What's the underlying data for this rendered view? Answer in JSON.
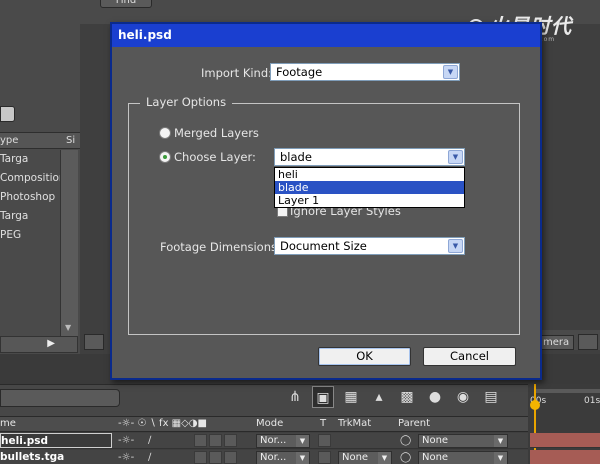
{
  "dialog": {
    "title": "heli.psd",
    "import_kind_label": "Import Kind:",
    "import_kind_value": "Footage",
    "layer_options_label": "Layer Options",
    "merged_layers_label": "Merged Layers",
    "choose_layer_label": "Choose Layer:",
    "choose_layer_value": "blade",
    "layer_options": [
      "heli",
      "blade",
      "Layer 1"
    ],
    "ignore_layer_styles_label": "Ignore Layer Styles",
    "footage_dimensions_label": "Footage Dimensions:",
    "footage_dimensions_value": "Document Size",
    "ok_label": "OK",
    "cancel_label": "Cancel"
  },
  "project_panel": {
    "find_label": "Find",
    "column_type": "ype",
    "column_size": "Si",
    "types": [
      "Targa",
      "Composition",
      "Photoshop",
      "Targa",
      "PEG"
    ]
  },
  "viewer": {
    "camera_label": "mera"
  },
  "timeline": {
    "columns": {
      "name": "me",
      "mode": "Mode",
      "t": "T",
      "trkmat": "TrkMat",
      "parent": "Parent"
    },
    "layers": [
      {
        "name": "heli.psd",
        "mode": "Nor...",
        "trkmat": "",
        "parent": "None"
      },
      {
        "name": "bullets.tga",
        "mode": "Nor...",
        "trkmat": "None",
        "parent": "None"
      }
    ],
    "ruler": {
      "start": "00s",
      "mark": "01s"
    }
  },
  "watermark": {
    "brand": "火星时代",
    "url": "www.hxsd.com"
  },
  "colors": {
    "titlebar": "#1a3fd0",
    "selection": "#2a52c4",
    "dialog_bg": "#575757",
    "workspace_bg": "#3f3f3f",
    "playhead": "#e9a400"
  }
}
